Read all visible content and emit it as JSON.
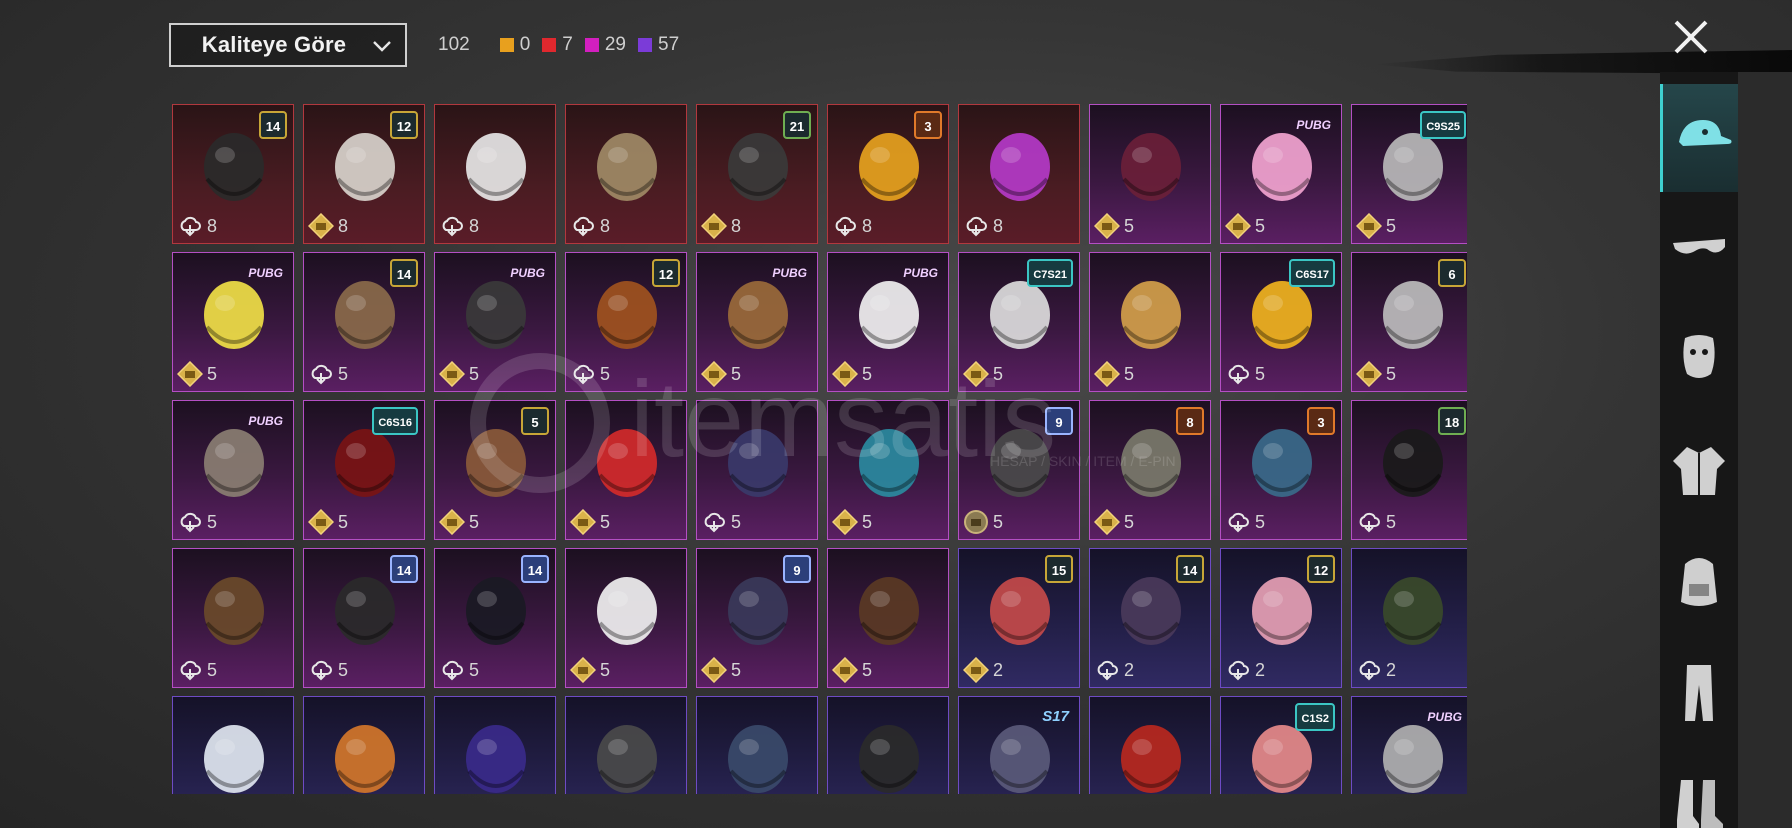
{
  "sort": {
    "label": "Kaliteye Göre"
  },
  "counts": {
    "total": "102",
    "items": [
      {
        "name": "legendary",
        "value": "0",
        "color": "#e8a01e"
      },
      {
        "name": "mythic",
        "value": "7",
        "color": "#e0282e"
      },
      {
        "name": "epic",
        "value": "29",
        "color": "#d31fbf"
      },
      {
        "name": "rare",
        "value": "57",
        "color": "#7b3bd8"
      }
    ]
  },
  "watermark": {
    "brand": "itemsatis",
    "tagline": "HESAP / SKIN / ITEM / E-PIN"
  },
  "cards": [
    {
      "q": "red",
      "badge": "14",
      "bt": "",
      "price": "8",
      "ic": "cloud",
      "art": "cat-mask"
    },
    {
      "q": "red",
      "badge": "12",
      "bt": "",
      "price": "8",
      "ic": "diamond",
      "art": "white-hair"
    },
    {
      "q": "red",
      "badge": "",
      "bt": "",
      "price": "8",
      "ic": "cloud",
      "art": "white-hat"
    },
    {
      "q": "red",
      "badge": "",
      "bt": "",
      "price": "8",
      "ic": "cloud",
      "art": "blonde-hair"
    },
    {
      "q": "red",
      "badge": "21",
      "bt": "green",
      "price": "8",
      "ic": "diamond",
      "art": "demon-mask"
    },
    {
      "q": "red",
      "badge": "3",
      "bt": "orange",
      "price": "8",
      "ic": "cloud",
      "art": "fries"
    },
    {
      "q": "red",
      "badge": "",
      "bt": "",
      "price": "8",
      "ic": "cloud",
      "art": "pink-helmet"
    },
    {
      "q": "mag",
      "badge": "",
      "bt": "",
      "price": "5",
      "ic": "diamond",
      "art": "purple-hair"
    },
    {
      "q": "mag",
      "badge": "PUBG",
      "bt": "pop",
      "price": "5",
      "ic": "diamond",
      "art": "bow-band"
    },
    {
      "q": "mag",
      "badge": "C9S25",
      "bt": "teal",
      "price": "5",
      "ic": "diamond",
      "art": "silver-hair"
    },
    {
      "q": "mag",
      "badge": "PUBG",
      "bt": "pop",
      "price": "5",
      "ic": "diamond",
      "art": "box-head"
    },
    {
      "q": "mag",
      "badge": "14",
      "bt": "",
      "price": "5",
      "ic": "cloud",
      "art": "flower-hair"
    },
    {
      "q": "mag",
      "badge": "PUBG",
      "bt": "pop",
      "price": "5",
      "ic": "diamond",
      "art": "cap-goggles"
    },
    {
      "q": "mag",
      "badge": "12",
      "bt": "",
      "price": "5",
      "ic": "cloud",
      "art": "orange-hair"
    },
    {
      "q": "mag",
      "badge": "PUBG",
      "bt": "pop",
      "price": "5",
      "ic": "diamond",
      "art": "alpaca"
    },
    {
      "q": "mag",
      "badge": "PUBG",
      "bt": "pop",
      "price": "5",
      "ic": "diamond",
      "art": "panda"
    },
    {
      "q": "mag",
      "badge": "C7S21",
      "bt": "teal",
      "price": "5",
      "ic": "diamond",
      "art": "fur-hat"
    },
    {
      "q": "mag",
      "badge": "",
      "bt": "",
      "price": "5",
      "ic": "diamond",
      "art": "long-blonde"
    },
    {
      "q": "mag",
      "badge": "C6S17",
      "bt": "teal",
      "price": "5",
      "ic": "cloud",
      "art": "visor"
    },
    {
      "q": "mag",
      "badge": "6",
      "bt": "",
      "price": "5",
      "ic": "diamond",
      "art": "knight-mask"
    },
    {
      "q": "mag",
      "badge": "PUBG",
      "bt": "pop",
      "price": "5",
      "ic": "cloud",
      "art": "sack-mask"
    },
    {
      "q": "mag",
      "badge": "C6S16",
      "bt": "teal",
      "price": "5",
      "ic": "diamond",
      "art": "red-hair"
    },
    {
      "q": "mag",
      "badge": "5",
      "bt": "",
      "price": "5",
      "ic": "diamond",
      "art": "pigtails"
    },
    {
      "q": "mag",
      "badge": "",
      "bt": "",
      "price": "5",
      "ic": "diamond",
      "art": "dragon-mask"
    },
    {
      "q": "mag",
      "badge": "",
      "bt": "",
      "price": "5",
      "ic": "cloud",
      "art": "headphones"
    },
    {
      "q": "mag",
      "badge": "",
      "bt": "",
      "price": "5",
      "ic": "diamond",
      "art": "robot-head"
    },
    {
      "q": "mag",
      "badge": "9",
      "bt": "blue",
      "price": "5",
      "ic": "gold",
      "art": "metal-helmet"
    },
    {
      "q": "mag",
      "badge": "8",
      "bt": "orange",
      "price": "5",
      "ic": "diamond",
      "art": "tower-hat"
    },
    {
      "q": "mag",
      "badge": "3",
      "bt": "orange",
      "price": "5",
      "ic": "cloud",
      "art": "tech-cap"
    },
    {
      "q": "mag",
      "badge": "18",
      "bt": "green",
      "price": "5",
      "ic": "cloud",
      "art": "baseball-cap"
    },
    {
      "q": "mag",
      "badge": "",
      "bt": "",
      "price": "5",
      "ic": "cloud",
      "art": "cowboy"
    },
    {
      "q": "mag",
      "badge": "14",
      "bt": "blue",
      "price": "5",
      "ic": "cloud",
      "art": "officer-cap"
    },
    {
      "q": "mag",
      "badge": "14",
      "bt": "blue",
      "price": "5",
      "ic": "cloud",
      "art": "police-cap"
    },
    {
      "q": "mag",
      "badge": "",
      "bt": "",
      "price": "5",
      "ic": "diamond",
      "art": "beanie"
    },
    {
      "q": "mag",
      "badge": "9",
      "bt": "blue",
      "price": "5",
      "ic": "diamond",
      "art": "straw-hat"
    },
    {
      "q": "mag",
      "badge": "",
      "bt": "",
      "price": "5",
      "ic": "diamond",
      "art": "headband"
    },
    {
      "q": "pur",
      "badge": "15",
      "bt": "",
      "price": "2",
      "ic": "diamond",
      "art": "pumpkin"
    },
    {
      "q": "pur",
      "badge": "14",
      "bt": "",
      "price": "2",
      "ic": "cloud",
      "art": "cap-hair"
    },
    {
      "q": "pur",
      "badge": "12",
      "bt": "",
      "price": "2",
      "ic": "cloud",
      "art": "bunny"
    },
    {
      "q": "pur",
      "badge": "",
      "bt": "",
      "price": "2",
      "ic": "cloud",
      "art": "military-cap"
    },
    {
      "q": "pur",
      "badge": "",
      "bt": "",
      "price": "",
      "ic": "",
      "art": "white-cap"
    },
    {
      "q": "pur",
      "badge": "",
      "bt": "",
      "price": "",
      "ic": "",
      "art": "goggles-hair"
    },
    {
      "q": "pur",
      "badge": "",
      "bt": "",
      "price": "",
      "ic": "",
      "art": "purple-hood"
    },
    {
      "q": "pur",
      "badge": "",
      "bt": "",
      "price": "",
      "ic": "",
      "art": "gray-cap"
    },
    {
      "q": "pur",
      "badge": "",
      "bt": "",
      "price": "",
      "ic": "",
      "art": "blue-beanie"
    },
    {
      "q": "pur",
      "badge": "",
      "bt": "",
      "price": "",
      "ic": "",
      "art": "bucket-hat"
    },
    {
      "q": "pur",
      "badge": "S17",
      "bt": "s17",
      "price": "",
      "ic": "",
      "art": "horn-helmet"
    },
    {
      "q": "pur",
      "badge": "",
      "bt": "",
      "price": "",
      "ic": "",
      "art": "red-beret"
    },
    {
      "q": "pur",
      "badge": "C1S2",
      "bt": "teal",
      "price": "",
      "ic": "",
      "art": "flag-bandana"
    },
    {
      "q": "pur",
      "badge": "PUBG",
      "bt": "pop",
      "price": "",
      "ic": "",
      "art": "gray-hair"
    }
  ],
  "sidebar": [
    {
      "name": "cap-icon",
      "active": true
    },
    {
      "name": "glasses-icon",
      "active": false
    },
    {
      "name": "mask-icon",
      "active": false
    },
    {
      "name": "jacket-icon",
      "active": false
    },
    {
      "name": "backpack-icon",
      "active": false
    },
    {
      "name": "pants-icon",
      "active": false
    },
    {
      "name": "boots-icon",
      "active": false
    }
  ]
}
